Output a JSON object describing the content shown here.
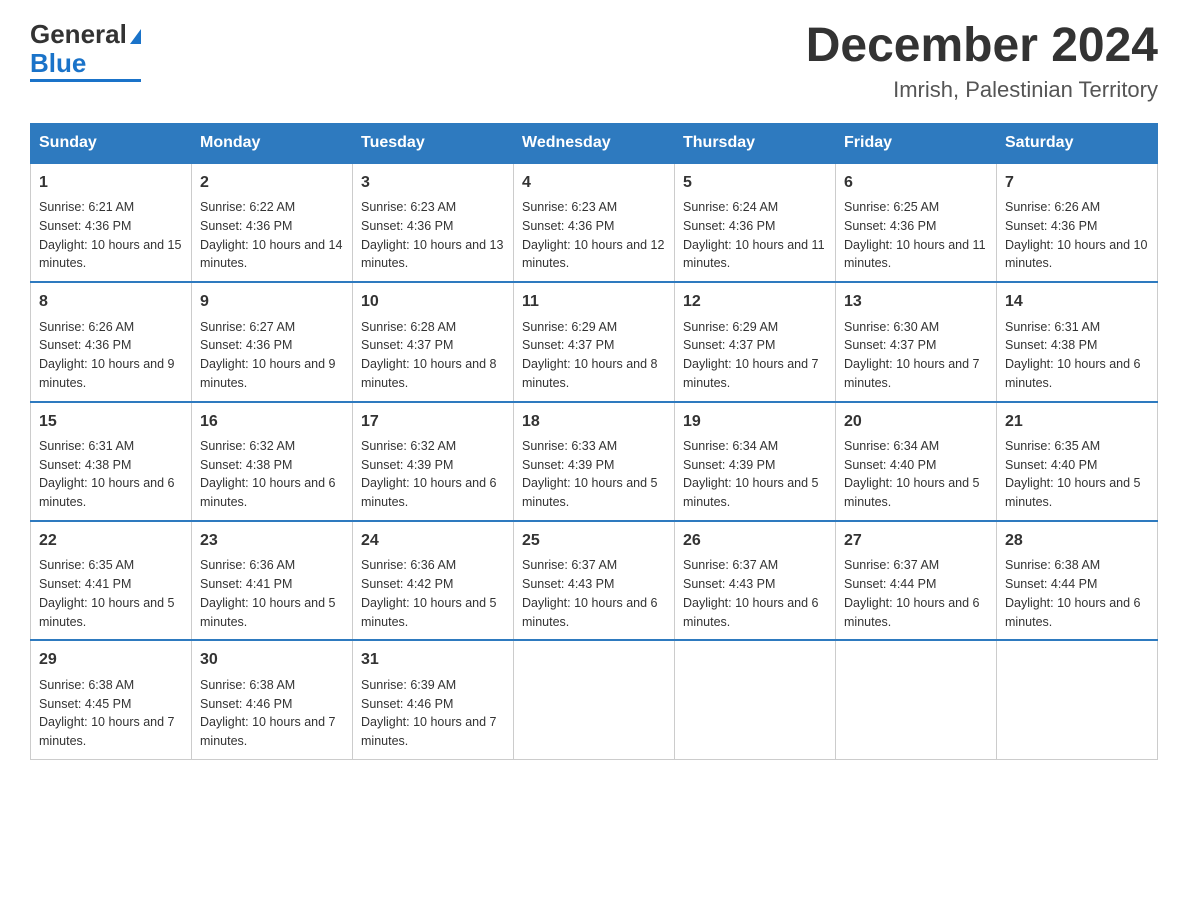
{
  "header": {
    "logo_text1": "General",
    "logo_text2": "Blue",
    "month_title": "December 2024",
    "location": "Imrish, Palestinian Territory"
  },
  "days_of_week": [
    "Sunday",
    "Monday",
    "Tuesday",
    "Wednesday",
    "Thursday",
    "Friday",
    "Saturday"
  ],
  "weeks": [
    [
      {
        "num": "1",
        "sunrise": "6:21 AM",
        "sunset": "4:36 PM",
        "daylight": "10 hours and 15 minutes."
      },
      {
        "num": "2",
        "sunrise": "6:22 AM",
        "sunset": "4:36 PM",
        "daylight": "10 hours and 14 minutes."
      },
      {
        "num": "3",
        "sunrise": "6:23 AM",
        "sunset": "4:36 PM",
        "daylight": "10 hours and 13 minutes."
      },
      {
        "num": "4",
        "sunrise": "6:23 AM",
        "sunset": "4:36 PM",
        "daylight": "10 hours and 12 minutes."
      },
      {
        "num": "5",
        "sunrise": "6:24 AM",
        "sunset": "4:36 PM",
        "daylight": "10 hours and 11 minutes."
      },
      {
        "num": "6",
        "sunrise": "6:25 AM",
        "sunset": "4:36 PM",
        "daylight": "10 hours and 11 minutes."
      },
      {
        "num": "7",
        "sunrise": "6:26 AM",
        "sunset": "4:36 PM",
        "daylight": "10 hours and 10 minutes."
      }
    ],
    [
      {
        "num": "8",
        "sunrise": "6:26 AM",
        "sunset": "4:36 PM",
        "daylight": "10 hours and 9 minutes."
      },
      {
        "num": "9",
        "sunrise": "6:27 AM",
        "sunset": "4:36 PM",
        "daylight": "10 hours and 9 minutes."
      },
      {
        "num": "10",
        "sunrise": "6:28 AM",
        "sunset": "4:37 PM",
        "daylight": "10 hours and 8 minutes."
      },
      {
        "num": "11",
        "sunrise": "6:29 AM",
        "sunset": "4:37 PM",
        "daylight": "10 hours and 8 minutes."
      },
      {
        "num": "12",
        "sunrise": "6:29 AM",
        "sunset": "4:37 PM",
        "daylight": "10 hours and 7 minutes."
      },
      {
        "num": "13",
        "sunrise": "6:30 AM",
        "sunset": "4:37 PM",
        "daylight": "10 hours and 7 minutes."
      },
      {
        "num": "14",
        "sunrise": "6:31 AM",
        "sunset": "4:38 PM",
        "daylight": "10 hours and 6 minutes."
      }
    ],
    [
      {
        "num": "15",
        "sunrise": "6:31 AM",
        "sunset": "4:38 PM",
        "daylight": "10 hours and 6 minutes."
      },
      {
        "num": "16",
        "sunrise": "6:32 AM",
        "sunset": "4:38 PM",
        "daylight": "10 hours and 6 minutes."
      },
      {
        "num": "17",
        "sunrise": "6:32 AM",
        "sunset": "4:39 PM",
        "daylight": "10 hours and 6 minutes."
      },
      {
        "num": "18",
        "sunrise": "6:33 AM",
        "sunset": "4:39 PM",
        "daylight": "10 hours and 5 minutes."
      },
      {
        "num": "19",
        "sunrise": "6:34 AM",
        "sunset": "4:39 PM",
        "daylight": "10 hours and 5 minutes."
      },
      {
        "num": "20",
        "sunrise": "6:34 AM",
        "sunset": "4:40 PM",
        "daylight": "10 hours and 5 minutes."
      },
      {
        "num": "21",
        "sunrise": "6:35 AM",
        "sunset": "4:40 PM",
        "daylight": "10 hours and 5 minutes."
      }
    ],
    [
      {
        "num": "22",
        "sunrise": "6:35 AM",
        "sunset": "4:41 PM",
        "daylight": "10 hours and 5 minutes."
      },
      {
        "num": "23",
        "sunrise": "6:36 AM",
        "sunset": "4:41 PM",
        "daylight": "10 hours and 5 minutes."
      },
      {
        "num": "24",
        "sunrise": "6:36 AM",
        "sunset": "4:42 PM",
        "daylight": "10 hours and 5 minutes."
      },
      {
        "num": "25",
        "sunrise": "6:37 AM",
        "sunset": "4:43 PM",
        "daylight": "10 hours and 6 minutes."
      },
      {
        "num": "26",
        "sunrise": "6:37 AM",
        "sunset": "4:43 PM",
        "daylight": "10 hours and 6 minutes."
      },
      {
        "num": "27",
        "sunrise": "6:37 AM",
        "sunset": "4:44 PM",
        "daylight": "10 hours and 6 minutes."
      },
      {
        "num": "28",
        "sunrise": "6:38 AM",
        "sunset": "4:44 PM",
        "daylight": "10 hours and 6 minutes."
      }
    ],
    [
      {
        "num": "29",
        "sunrise": "6:38 AM",
        "sunset": "4:45 PM",
        "daylight": "10 hours and 7 minutes."
      },
      {
        "num": "30",
        "sunrise": "6:38 AM",
        "sunset": "4:46 PM",
        "daylight": "10 hours and 7 minutes."
      },
      {
        "num": "31",
        "sunrise": "6:39 AM",
        "sunset": "4:46 PM",
        "daylight": "10 hours and 7 minutes."
      },
      null,
      null,
      null,
      null
    ]
  ]
}
